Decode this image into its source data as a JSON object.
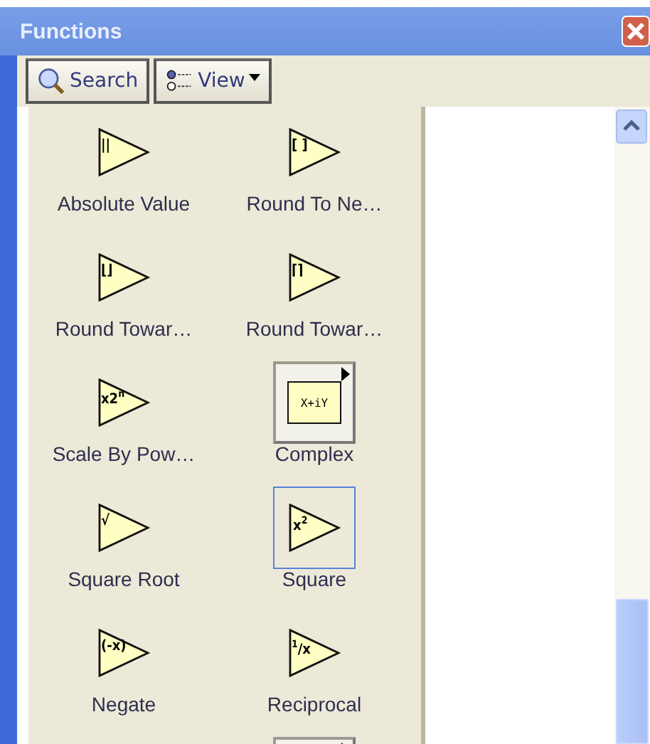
{
  "window": {
    "title": "Functions"
  },
  "toolbar": [
    {
      "kind": "search",
      "label": "Search"
    },
    {
      "kind": "view",
      "label": "View"
    }
  ],
  "items": [
    {
      "kind": "function",
      "glyph": "||",
      "label": "Absolute Value",
      "selected": false
    },
    {
      "kind": "function",
      "glyph": "[ ]",
      "label": "Round To Ne…",
      "selected": false
    },
    {
      "kind": "function",
      "glyph": "⌊⌋",
      "label": "Round Towar…",
      "selected": false
    },
    {
      "kind": "function",
      "glyph": "⌈⌉",
      "label": "Round Towar…",
      "selected": false
    },
    {
      "kind": "function",
      "glyph": "x2$^{n}$",
      "label": "Scale By Pow…",
      "selected": false
    },
    {
      "kind": "subpalette",
      "glyph": "X+iY",
      "label": "Complex",
      "selected": false
    },
    {
      "kind": "function",
      "glyph": "√",
      "label": "Square Root",
      "selected": false
    },
    {
      "kind": "function",
      "glyph": "x$^{2}$",
      "label": "Square",
      "selected": true
    },
    {
      "kind": "function",
      "glyph": "(-x)",
      "label": "Negate",
      "selected": false
    },
    {
      "kind": "function",
      "glyph": "$^{1}$/x",
      "label": "Reciprocal",
      "selected": false
    },
    {
      "kind": "empty"
    },
    {
      "kind": "subpalette",
      "selected": false
    }
  ]
}
